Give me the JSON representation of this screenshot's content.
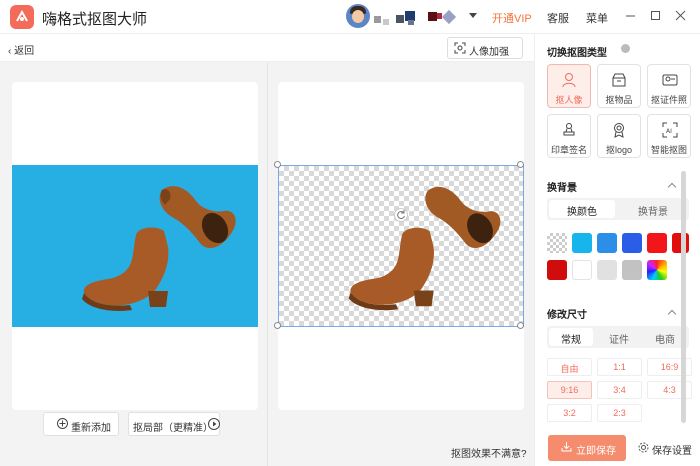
{
  "app": {
    "title": "嗨格式抠图大师"
  },
  "header": {
    "vip_label": "开通VIP",
    "service_label": "客服",
    "menu_label": "菜单"
  },
  "toolbar": {
    "back_label": "返回",
    "enhance_label": "人像加强"
  },
  "canvas": {
    "readd_label": "重新添加",
    "partial_label": "抠局部（更精准）",
    "unsatisfied_label": "抠图效果不满意?"
  },
  "panel": {
    "type_title": "切换抠图类型",
    "types": [
      {
        "label": "抠人像",
        "icon": "person-icon",
        "active": true
      },
      {
        "label": "抠物品",
        "icon": "box-icon",
        "active": false
      },
      {
        "label": "抠证件照",
        "icon": "id-card-icon",
        "active": false
      },
      {
        "label": "印章签名",
        "icon": "stamp-icon",
        "active": false
      },
      {
        "label": "抠logo",
        "icon": "badge-icon",
        "active": false
      },
      {
        "label": "智能抠图",
        "icon": "ai-scan-icon",
        "active": false
      }
    ],
    "bg_title": "换背景",
    "bg_tabs": [
      "换颜色",
      "换背景"
    ],
    "colors": [
      "transparent",
      "#16b6ec",
      "#2b8fe8",
      "#2a5de8",
      "#f2161a",
      "#e20d0d",
      "#d00c0c",
      "#ffffff",
      "#e1e1e1",
      "#c2c2c2",
      "rainbow"
    ],
    "size_title": "修改尺寸",
    "size_tabs": [
      "常规",
      "证件",
      "电商"
    ],
    "ratios": [
      "自由",
      "1:1",
      "16:9",
      "9:16",
      "3:4",
      "4:3",
      "3:2",
      "2:3"
    ],
    "active_ratio": "9:16",
    "save_label": "立即保存",
    "save_settings_label": "保存设置"
  }
}
